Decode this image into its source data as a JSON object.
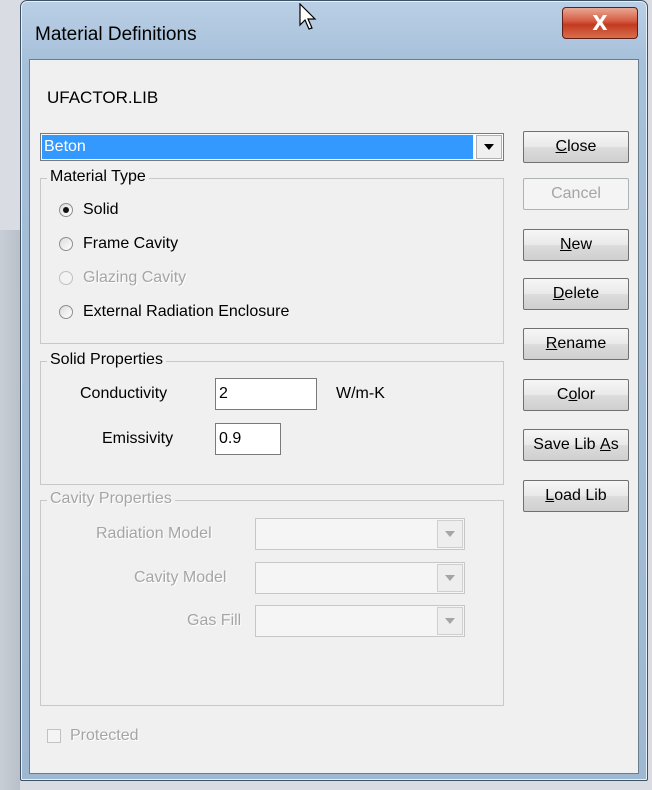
{
  "window": {
    "title": "Material Definitions",
    "close_glyph": "X"
  },
  "library_name": "UFACTOR.LIB",
  "material_combo": {
    "selected": "Beton"
  },
  "material_type": {
    "legend": "Material Type",
    "options": [
      {
        "label": "Solid",
        "checked": true,
        "enabled": true
      },
      {
        "label": "Frame Cavity",
        "checked": false,
        "enabled": true
      },
      {
        "label": "Glazing Cavity",
        "checked": false,
        "enabled": false
      },
      {
        "label": "External Radiation Enclosure",
        "checked": false,
        "enabled": true
      }
    ]
  },
  "solid_properties": {
    "legend": "Solid Properties",
    "conductivity_label": "Conductivity",
    "conductivity_value": "2",
    "conductivity_unit": "W/m-K",
    "emissivity_label": "Emissivity",
    "emissivity_value": "0.9"
  },
  "cavity_properties": {
    "legend": "Cavity Properties",
    "radiation_mode_label": "Radiation Model",
    "cavity_model_label": "Cavity Model",
    "gas_fill_label": "Gas Fill"
  },
  "protected_label": "Protected",
  "buttons": {
    "close": {
      "pre": "",
      "key": "C",
      "post": "lose"
    },
    "cancel": {
      "label": "Cancel"
    },
    "new": {
      "pre": "",
      "key": "N",
      "post": "ew"
    },
    "delete": {
      "pre": "",
      "key": "D",
      "post": "elete"
    },
    "rename": {
      "pre": "",
      "key": "R",
      "post": "ename"
    },
    "color": {
      "pre": "C",
      "key": "o",
      "post": "lor"
    },
    "save_lib_as": {
      "pre": "Save Lib ",
      "key": "A",
      "post": "s"
    },
    "load_lib": {
      "pre": "",
      "key": "L",
      "post": "oad Lib"
    }
  }
}
